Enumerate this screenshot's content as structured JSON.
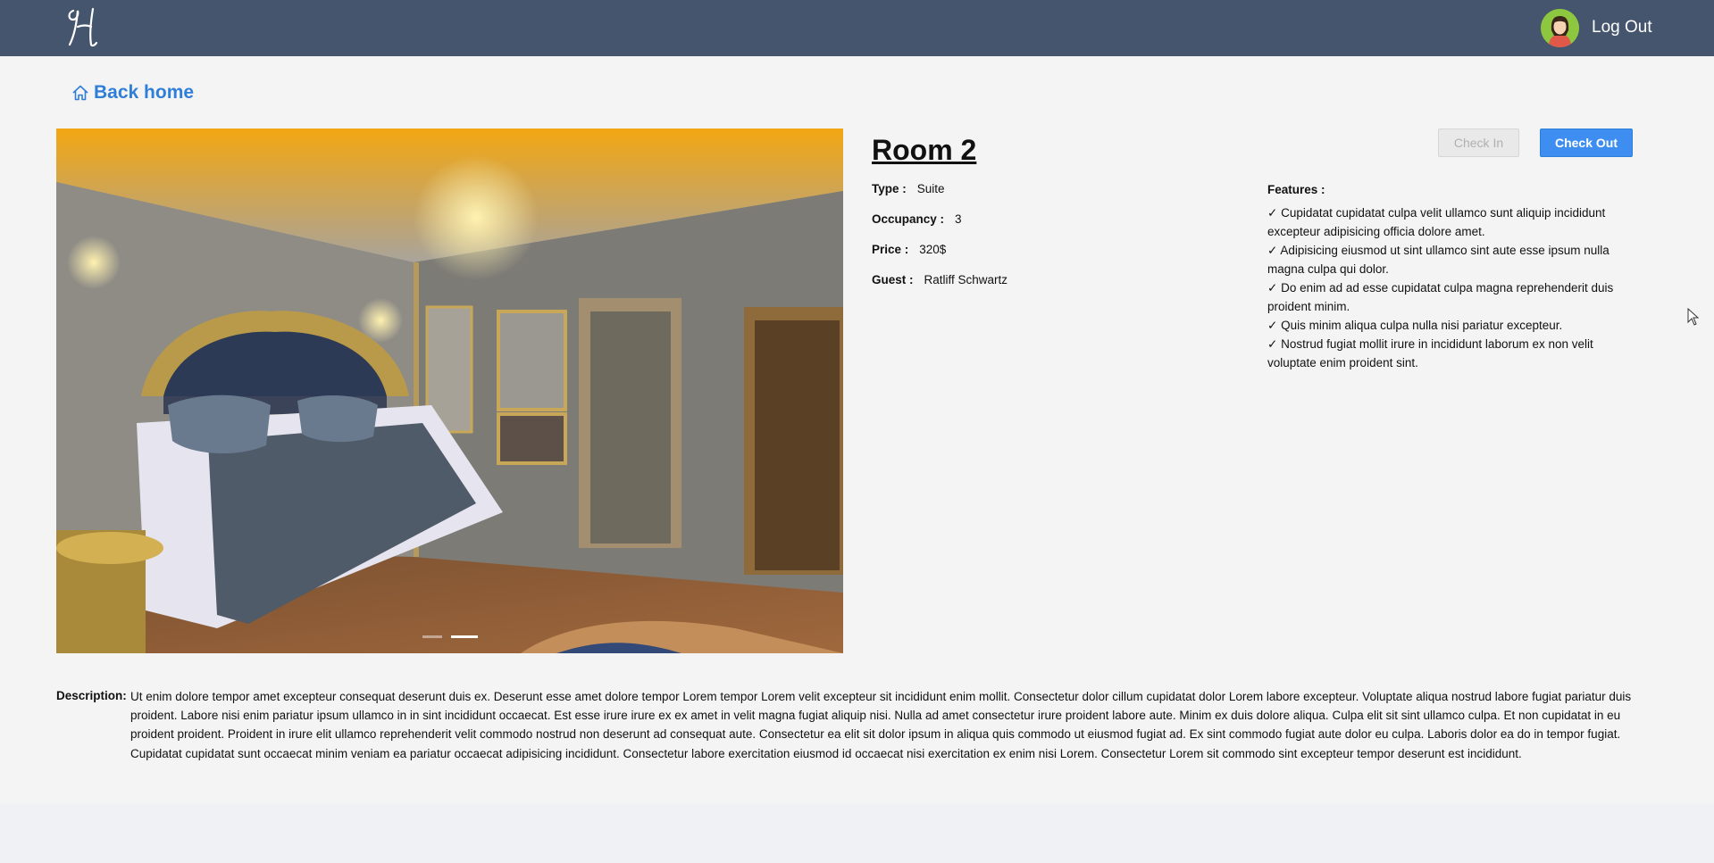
{
  "header": {
    "logo_letter": "H",
    "logout_label": "Log Out"
  },
  "nav": {
    "back_label": "Back home"
  },
  "room": {
    "title": "Room 2",
    "details": [
      {
        "label": "Type :",
        "value": "Suite"
      },
      {
        "label": "Occupancy :",
        "value": "3"
      },
      {
        "label": "Price :",
        "value": "320$"
      },
      {
        "label": "Guest :",
        "value": "Ratliff Schwartz"
      }
    ],
    "actions": {
      "check_in_label": "Check In",
      "check_out_label": "Check Out"
    },
    "features_title": "Features :",
    "features": [
      "Cupidatat cupidatat culpa velit ullamco sunt aliquip incididunt excepteur adipisicing officia dolore amet.",
      "Adipisicing eiusmod ut sint ullamco sint aute esse ipsum nulla magna culpa qui dolor.",
      "Do enim ad ad esse cupidatat culpa magna reprehenderit duis proident minim.",
      "Quis minim aliqua culpa nulla nisi pariatur excepteur.",
      "Nostrud fugiat mollit irure in incididunt laborum ex non velit voluptate enim proident sint."
    ],
    "check_glyph": "✓",
    "description_label": "Description:",
    "description": "Ut enim dolore tempor amet excepteur consequat deserunt duis ex. Deserunt esse amet dolore tempor Lorem tempor Lorem velit excepteur sit incididunt enim mollit. Consectetur dolor cillum cupidatat dolor Lorem labore excepteur. Voluptate aliqua nostrud labore fugiat pariatur duis proident. Labore nisi enim pariatur ipsum ullamco in in sint incididunt occaecat. Est esse irure irure ex ex amet in velit magna fugiat aliquip nisi. Nulla ad amet consectetur irure proident labore aute. Minim ex duis dolore aliqua. Culpa elit sit sint ullamco culpa. Et non cupidatat in eu proident proident. Proident in irure elit ullamco reprehenderit velit commodo nostrud non deserunt ad consequat aute. Consectetur ea elit sit dolor ipsum in aliqua quis commodo ut eiusmod fugiat ad. Ex sint commodo fugiat aute dolor eu culpa. Laboris dolor ea do in tempor fugiat. Cupidatat cupidatat sunt occaecat minim veniam ea pariatur occaecat adipisicing incididunt. Consectetur labore exercitation eiusmod id occaecat nisi exercitation ex enim nisi Lorem. Consectetur Lorem sit commodo sint excepteur tempor deserunt est incididunt."
  },
  "carousel": {
    "slide_count": 2,
    "active_slide": 2
  },
  "colors": {
    "header_bg": "#45556e",
    "accent": "#3d8ef0",
    "link": "#2f7fd8"
  },
  "icons": [
    "logo-icon",
    "avatar",
    "home-icon",
    "check-icon",
    "cursor-icon"
  ]
}
